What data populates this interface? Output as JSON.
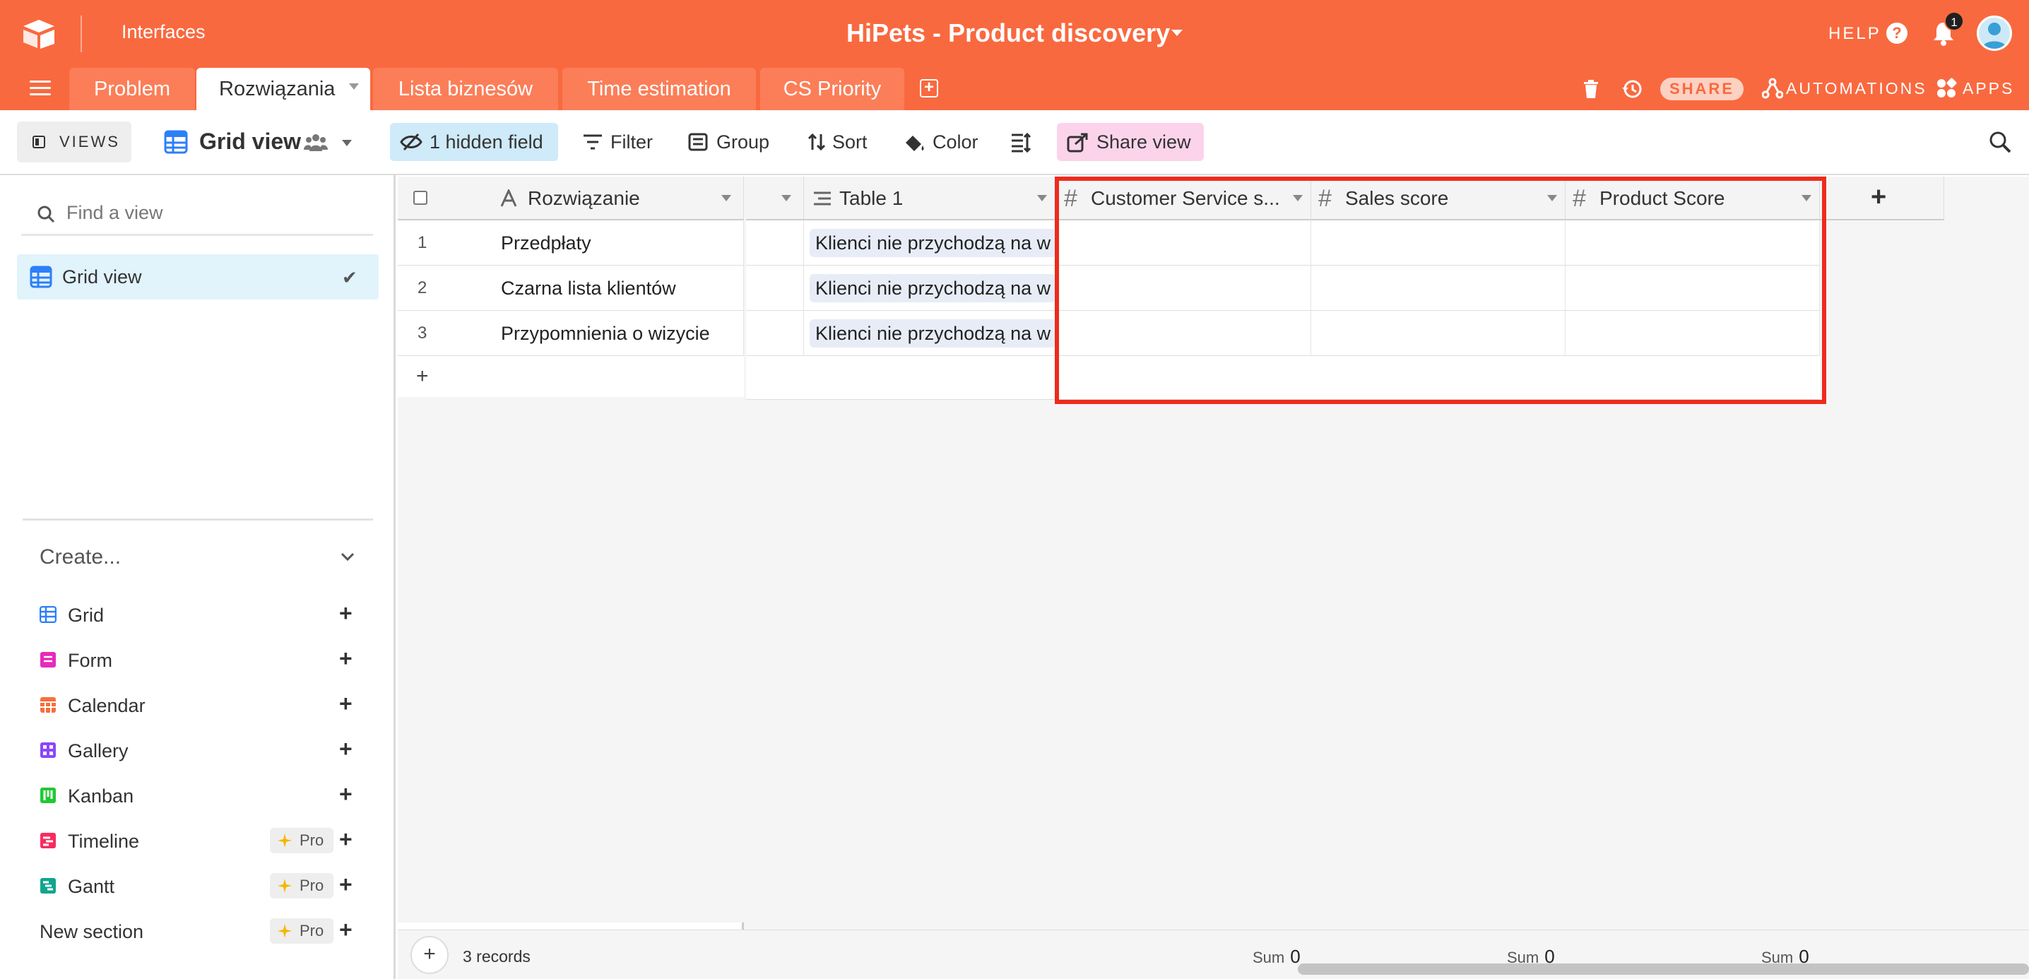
{
  "topbar": {
    "interfaces_label": "Interfaces",
    "base_title": "HiPets - Product discovery",
    "help_label": "HELP",
    "notification_count": "1",
    "share_label": "SHARE",
    "automations_label": "AUTOMATIONS",
    "apps_label": "APPS",
    "accent_color": "#f9693f"
  },
  "tabs": [
    {
      "label": "Problem",
      "active": false
    },
    {
      "label": "Rozwiązania",
      "active": true
    },
    {
      "label": "Lista biznesów",
      "active": false
    },
    {
      "label": "Time estimation",
      "active": false
    },
    {
      "label": "CS Priority",
      "active": false
    }
  ],
  "toolbar": {
    "views_label": "VIEWS",
    "view_name": "Grid view",
    "hidden_field_label": "1 hidden field",
    "filter_label": "Filter",
    "group_label": "Group",
    "sort_label": "Sort",
    "color_label": "Color",
    "share_view_label": "Share view"
  },
  "sidebar": {
    "find_placeholder": "Find a view",
    "selected_view": "Grid view",
    "create_label": "Create...",
    "create_items": [
      {
        "label": "Grid",
        "icon": "grid-icon",
        "color": "#2d7ff9",
        "pro": false
      },
      {
        "label": "Form",
        "icon": "form-icon",
        "color": "#e929ba",
        "pro": false
      },
      {
        "label": "Calendar",
        "icon": "calendar-icon",
        "color": "#f86e3d",
        "pro": false
      },
      {
        "label": "Gallery",
        "icon": "gallery-icon",
        "color": "#8b46ff",
        "pro": false
      },
      {
        "label": "Kanban",
        "icon": "kanban-icon",
        "color": "#20c933",
        "pro": false
      },
      {
        "label": "Timeline",
        "icon": "timeline-icon",
        "color": "#f82b60",
        "pro": true
      },
      {
        "label": "Gantt",
        "icon": "gantt-icon",
        "color": "#11a58c",
        "pro": true
      }
    ],
    "new_section_label": "New section",
    "pro_label": "Pro"
  },
  "grid": {
    "columns": {
      "primary": "Rozwiązanie",
      "table1": "Table 1",
      "cs": "Customer Service s...",
      "sales": "Sales score",
      "product": "Product Score"
    },
    "rows": [
      {
        "num": "1",
        "name": "Przedpłaty",
        "link": "Klienci nie przychodzą na w"
      },
      {
        "num": "2",
        "name": "Czarna lista klientów",
        "link": "Klienci nie przychodzą na w"
      },
      {
        "num": "3",
        "name": "Przypomnienia o wizycie",
        "link": "Klienci nie przychodzą na w"
      }
    ],
    "records_label": "3 records",
    "sum_label": "Sum",
    "sum_values": {
      "cs": "0",
      "sales": "0",
      "product": "0"
    }
  }
}
